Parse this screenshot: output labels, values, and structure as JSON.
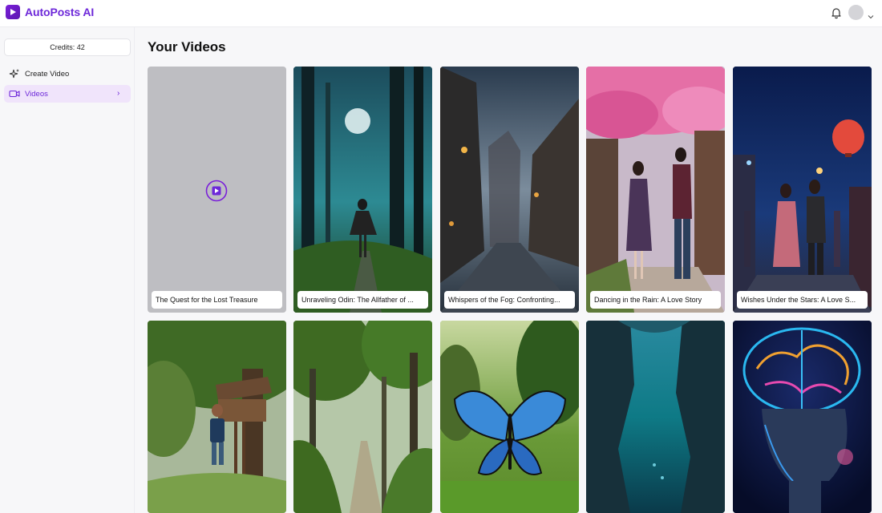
{
  "app": {
    "name": "AutoPosts AI"
  },
  "header": {
    "bell_icon": "bell-icon",
    "avatar": "user-avatar",
    "menu_icon": "chevron-down-icon"
  },
  "sidebar": {
    "credits": "Credits: 42",
    "items": [
      {
        "label": "Create Video",
        "icon": "sparkles-icon",
        "active": false
      },
      {
        "label": "Videos",
        "icon": "video-icon",
        "active": true
      }
    ]
  },
  "main": {
    "title": "Your Videos",
    "videos": [
      {
        "title": "The Quest for the Lost Treasure",
        "thumbnail": "placeholder"
      },
      {
        "title": "Unraveling Odin: The Allfather of ...",
        "thumbnail": "moonlit-forest-woman"
      },
      {
        "title": "Whispers of the Fog: Confronting...",
        "thumbnail": "foggy-cobblestone-street"
      },
      {
        "title": "Dancing in the Rain: A Love Story",
        "thumbnail": "couple-under-cherry-blossoms"
      },
      {
        "title": "Wishes Under the Stars: A Love S...",
        "thumbnail": "couple-night-market-lanterns"
      },
      {
        "title": "",
        "thumbnail": "boy-treehouse"
      },
      {
        "title": "",
        "thumbnail": "forest-path"
      },
      {
        "title": "",
        "thumbnail": "blue-butterfly"
      },
      {
        "title": "",
        "thumbnail": "underwater-cave"
      },
      {
        "title": "",
        "thumbnail": "glowing-brain-head"
      }
    ]
  },
  "colors": {
    "accent": "#6d28d9",
    "active_bg": "#f0e4fb",
    "placeholder_bg": "#bebec2"
  }
}
